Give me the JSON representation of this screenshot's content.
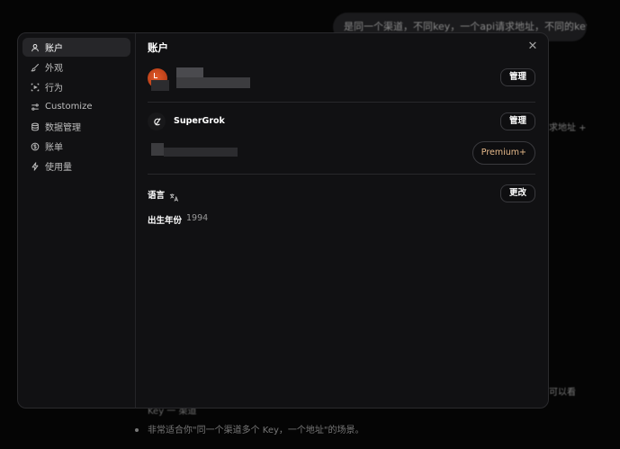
{
  "background": {
    "bubble_text": "是同一个渠道，不同key，一个api请求地址，不同的key",
    "right_fragment_1": "求地址 +",
    "right_fragment_2": "可以看",
    "bullet_line_partial": "Key 一 渠道",
    "bullet_line": "非常适合你\"同一个渠道多个 Key，一个地址\"的场景。"
  },
  "sidebar": {
    "items": [
      {
        "label": "账户",
        "icon": "user-icon",
        "active": true
      },
      {
        "label": "外观",
        "icon": "brush-icon",
        "active": false
      },
      {
        "label": "行为",
        "icon": "behavior-icon",
        "active": false
      },
      {
        "label": "Customize",
        "icon": "sliders-icon",
        "active": false
      },
      {
        "label": "数据管理",
        "icon": "database-icon",
        "active": false
      },
      {
        "label": "账单",
        "icon": "billing-icon",
        "active": false
      },
      {
        "label": "使用量",
        "icon": "lightning-icon",
        "active": false
      }
    ]
  },
  "content": {
    "title": "账户",
    "close_symbol": "✕",
    "account_row": {
      "manage_label": "管理"
    },
    "subscription": {
      "name": "SuperGrok",
      "manage_label": "管理",
      "upgrade_label": "Premium+"
    },
    "language": {
      "label": "语言",
      "change_label": "更改"
    },
    "birth_year": {
      "label": "出生年份",
      "value": "1994"
    }
  },
  "colors": {
    "modal_bg": "#111113",
    "accent_avatar": "#d2481e",
    "premium_text": "#e6b98a"
  }
}
